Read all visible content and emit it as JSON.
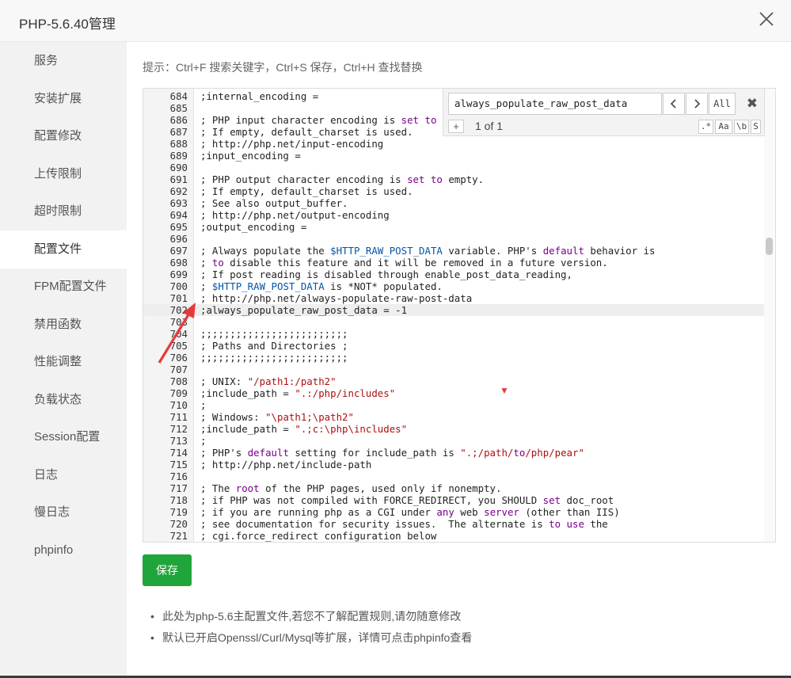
{
  "window": {
    "title": "PHP-5.6.40管理",
    "close_icon": "close-icon"
  },
  "sidebar": {
    "items": [
      {
        "label": "服务"
      },
      {
        "label": "安装扩展"
      },
      {
        "label": "配置修改"
      },
      {
        "label": "上传限制"
      },
      {
        "label": "超时限制"
      },
      {
        "label": "配置文件",
        "active": true
      },
      {
        "label": "FPM配置文件"
      },
      {
        "label": "禁用函数"
      },
      {
        "label": "性能调整"
      },
      {
        "label": "负载状态"
      },
      {
        "label": "Session配置"
      },
      {
        "label": "日志"
      },
      {
        "label": "慢日志"
      },
      {
        "label": "phpinfo"
      }
    ]
  },
  "main": {
    "hint": "提示：Ctrl+F 搜索关键字，Ctrl+S 保存，Ctrl+H 查找替换",
    "save_label": "保存",
    "notes": [
      "此处为php-5.6主配置文件,若您不了解配置规则,请勿随意修改",
      "默认已开启Openssl/Curl/Mysql等扩展，详情可点击phpinfo查看"
    ]
  },
  "search": {
    "value": "always_populate_raw_post_data",
    "prev_icon": "chevron-left-icon",
    "next_icon": "chevron-right-icon",
    "all_label": "All",
    "close_label": "✖",
    "plus_label": "+",
    "count": "1 of 1",
    "opt_regex": ".*",
    "opt_case": "Aa",
    "opt_word": "\\b",
    "opt_selection": "S"
  },
  "editor": {
    "highlighted_line": "702",
    "lines": [
      {
        "n": "684",
        "t": ";internal_encoding ="
      },
      {
        "n": "685",
        "t": ""
      },
      {
        "n": "686",
        "t": "; PHP input character encoding is set to empty."
      },
      {
        "n": "687",
        "t": "; If empty, default_charset is used."
      },
      {
        "n": "688",
        "t": "; http://php.net/input-encoding"
      },
      {
        "n": "689",
        "t": ";input_encoding ="
      },
      {
        "n": "690",
        "t": ""
      },
      {
        "n": "691",
        "t": "; PHP output character encoding is set to empty."
      },
      {
        "n": "692",
        "t": "; If empty, default_charset is used."
      },
      {
        "n": "693",
        "t": "; See also output_buffer."
      },
      {
        "n": "694",
        "t": "; http://php.net/output-encoding"
      },
      {
        "n": "695",
        "t": ";output_encoding ="
      },
      {
        "n": "696",
        "t": ""
      },
      {
        "n": "697",
        "t": "; Always populate the $HTTP_RAW_POST_DATA variable. PHP's default behavior is"
      },
      {
        "n": "698",
        "t": "; to disable this feature and it will be removed in a future version."
      },
      {
        "n": "699",
        "t": "; If post reading is disabled through enable_post_data_reading,"
      },
      {
        "n": "700",
        "t": "; $HTTP_RAW_POST_DATA is *NOT* populated."
      },
      {
        "n": "701",
        "t": "; http://php.net/always-populate-raw-post-data"
      },
      {
        "n": "702",
        "t": ";always_populate_raw_post_data = -1"
      },
      {
        "n": "703",
        "t": ""
      },
      {
        "n": "704",
        "t": ";;;;;;;;;;;;;;;;;;;;;;;;;"
      },
      {
        "n": "705",
        "t": "; Paths and Directories ;"
      },
      {
        "n": "706",
        "t": ";;;;;;;;;;;;;;;;;;;;;;;;;"
      },
      {
        "n": "707",
        "t": ""
      },
      {
        "n": "708",
        "t": "; UNIX: \"/path1:/path2\""
      },
      {
        "n": "709",
        "t": ";include_path = \".:/php/includes\""
      },
      {
        "n": "710",
        "t": ";"
      },
      {
        "n": "711",
        "t": "; Windows: \"\\path1;\\path2\""
      },
      {
        "n": "712",
        "t": ";include_path = \".;c:\\php\\includes\""
      },
      {
        "n": "713",
        "t": ";"
      },
      {
        "n": "714",
        "t": "; PHP's default setting for include_path is \".;/path/to/php/pear\""
      },
      {
        "n": "715",
        "t": "; http://php.net/include-path"
      },
      {
        "n": "716",
        "t": ""
      },
      {
        "n": "717",
        "t": "; The root of the PHP pages, used only if nonempty."
      },
      {
        "n": "718",
        "t": "; if PHP was not compiled with FORCE_REDIRECT, you SHOULD set doc_root"
      },
      {
        "n": "719",
        "t": "; if you are running php as a CGI under any web server (other than IIS)"
      },
      {
        "n": "720",
        "t": "; see documentation for security issues.  The alternate is to use the"
      },
      {
        "n": "721",
        "t": "; cgi.force_redirect configuration below"
      }
    ]
  },
  "colors": {
    "save_green": "#20a53a",
    "keyword": "#770088",
    "variable": "#0055aa",
    "string": "#aa1111",
    "annotation_red": "#e53a3a"
  }
}
